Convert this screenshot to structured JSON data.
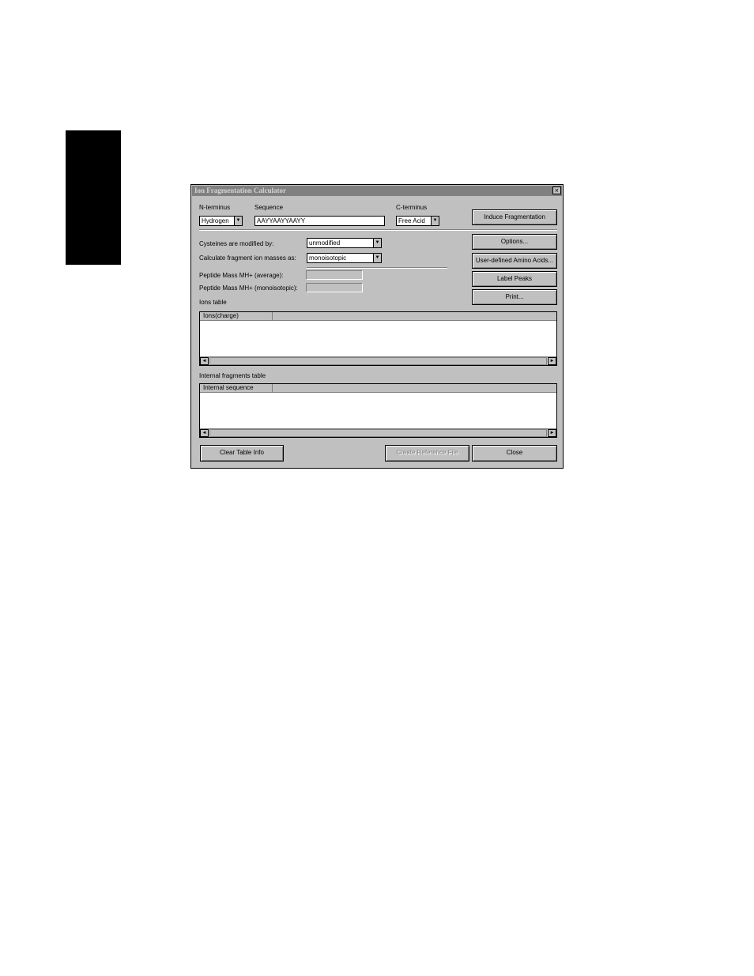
{
  "window": {
    "title": "Ion Fragmentation Calculator",
    "close_glyph": "×"
  },
  "n_terminus": {
    "label": "N-terminus",
    "value": "Hydrogen"
  },
  "sequence": {
    "label": "Sequence",
    "value": "AAYYAAYYAAYY"
  },
  "c_terminus": {
    "label": "C-terminus",
    "value": "Free Acid"
  },
  "cysteines": {
    "label": "Cysteines are modified by:",
    "value": "unmodified"
  },
  "fragment_masses": {
    "label": "Calculate fragment ion masses as:",
    "value": "monoisotopic"
  },
  "peptide_avg": {
    "label": "Peptide Mass MH+ (average):",
    "value": ""
  },
  "peptide_mono": {
    "label": "Peptide Mass MH+ (monoisotopic):",
    "value": ""
  },
  "buttons": {
    "induce": "Induce Fragmentation",
    "options": "Options...",
    "user_defined": "User-defined Amino Acids...",
    "label_peaks": "Label Peaks",
    "print": "Print...",
    "clear_table": "Clear Table Info",
    "create_ref": "Create Reference File",
    "close": "Close"
  },
  "ions_table": {
    "label": "Ions table",
    "columns": [
      "Ions(charge)",
      ""
    ]
  },
  "internal_table": {
    "label": "Internal fragments table",
    "columns": [
      "Internal sequence",
      ""
    ]
  },
  "icons": {
    "dropdown": "▼",
    "scroll_left": "◄",
    "scroll_right": "►"
  }
}
